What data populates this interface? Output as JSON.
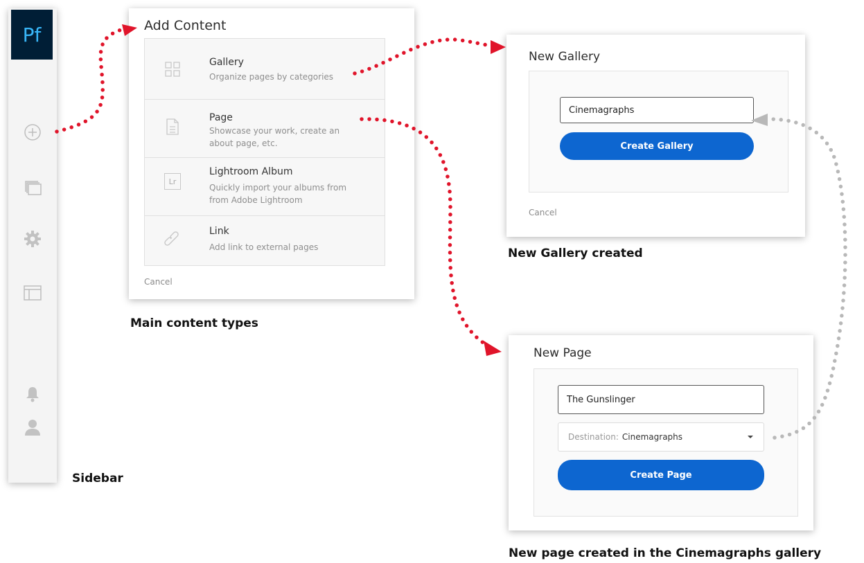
{
  "sidebar": {
    "logo": "Pf",
    "caption": "Sidebar"
  },
  "add_content": {
    "title": "Add Content",
    "items": [
      {
        "label": "Gallery",
        "description": "Organize pages by categories",
        "icon": "gallery-grid-icon"
      },
      {
        "label": "Page",
        "description": "Showcase your work, create an about page, etc.",
        "icon": "page-document-icon"
      },
      {
        "label": "Lightroom Album",
        "description": "Quickly import your albums from from Adobe Lightroom",
        "icon_text": "Lr"
      },
      {
        "label": "Link",
        "description": "Add link to external pages",
        "icon": "link-icon"
      }
    ],
    "cancel": "Cancel",
    "caption": "Main content types"
  },
  "new_gallery": {
    "title": "New Gallery",
    "name_value": "Cinemagraphs",
    "create_button": "Create Gallery",
    "cancel": "Cancel",
    "caption": "New Gallery created"
  },
  "new_page": {
    "title": "New Page",
    "name_value": "The Gunslinger",
    "destination_label": "Destination:",
    "destination_value": "Cinemagraphs",
    "create_button": "Create Page",
    "caption": "New page created in the Cinemagraphs gallery"
  },
  "colors": {
    "accent_blue": "#0d66d0",
    "arrow_red": "#e0142a",
    "arrow_gray": "#b8b8b8",
    "logo_bg": "#001e36",
    "logo_text": "#38b6f8"
  }
}
